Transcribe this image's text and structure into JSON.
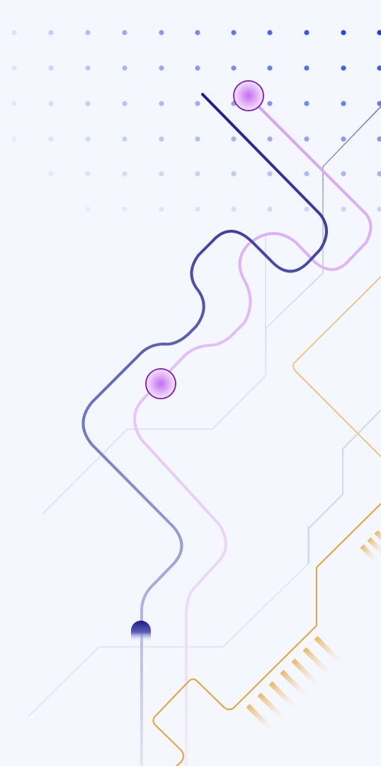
{
  "colors": {
    "background": "#f4f7fe",
    "navy": "#1f1a8a",
    "slate": "#5f63b8",
    "violet": "#c98ef0",
    "violet_ring": "#7a18b8",
    "amber": "#e3a23a",
    "grid_dot": "#1f3fe0"
  },
  "icons": {
    "node_marker": "violet-ring-dot",
    "terminal": "navy-half-circle"
  }
}
